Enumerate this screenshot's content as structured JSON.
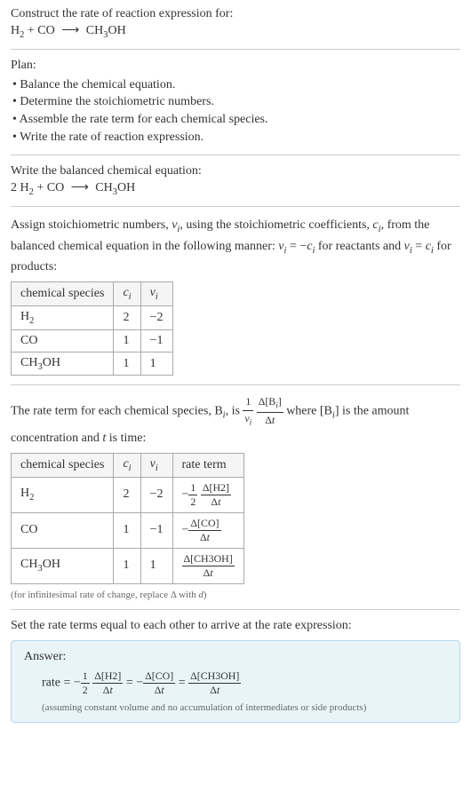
{
  "header": {
    "title": "Construct the rate of reaction expression for:",
    "equation_html": "H<span class='sub'>2</span> + CO <span class='arrow'>⟶</span> CH<span class='sub'>3</span>OH"
  },
  "plan": {
    "label": "Plan:",
    "items": [
      "• Balance the chemical equation.",
      "• Determine the stoichiometric numbers.",
      "• Assemble the rate term for each chemical species.",
      "• Write the rate of reaction expression."
    ]
  },
  "balanced": {
    "label": "Write the balanced chemical equation:",
    "equation_html": "2 H<span class='sub'>2</span> + CO <span class='arrow'>⟶</span> CH<span class='sub'>3</span>OH"
  },
  "stoich": {
    "intro_html": "Assign stoichiometric numbers, <span class='italic'>ν<span class='sub'>i</span></span>, using the stoichiometric coefficients, <span class='italic'>c<span class='sub'>i</span></span>, from the balanced chemical equation in the following manner: <span class='italic'>ν<span class='sub'>i</span></span> = −<span class='italic'>c<span class='sub'>i</span></span> for reactants and <span class='italic'>ν<span class='sub'>i</span></span> = <span class='italic'>c<span class='sub'>i</span></span> for products:",
    "headers": {
      "species": "chemical species",
      "ci_html": "<span class='italic'>c<span class='sub'>i</span></span>",
      "vi_html": "<span class='italic'>ν<span class='sub'>i</span></span>"
    },
    "rows": [
      {
        "species_html": "H<span class='sub'>2</span>",
        "ci": "2",
        "vi": "−2"
      },
      {
        "species_html": "CO",
        "ci": "1",
        "vi": "−1"
      },
      {
        "species_html": "CH<span class='sub'>3</span>OH",
        "ci": "1",
        "vi": "1"
      }
    ]
  },
  "rateterm": {
    "intro_html": "The rate term for each chemical species, B<span class='sub italic'>i</span>, is <span class='frac'><span class='num'>1</span><span class='den'><span class='italic'>ν<span class='sub'>i</span></span></span></span> <span class='frac'><span class='num'>Δ[B<span class='sub italic'>i</span>]</span><span class='den'>Δ<span class='italic'>t</span></span></span> where [B<span class='sub italic'>i</span>] is the amount concentration and <span class='italic'>t</span> is time:",
    "headers": {
      "species": "chemical species",
      "ci_html": "<span class='italic'>c<span class='sub'>i</span></span>",
      "vi_html": "<span class='italic'>ν<span class='sub'>i</span></span>",
      "rate": "rate term"
    },
    "rows": [
      {
        "species_html": "H<span class='sub'>2</span>",
        "ci": "2",
        "vi": "−2",
        "rate_html": "−<span class='frac'><span class='num'>1</span><span class='den'>2</span></span> <span class='frac'><span class='num'>Δ[H2]</span><span class='den'>Δ<span class='italic'>t</span></span></span>"
      },
      {
        "species_html": "CO",
        "ci": "1",
        "vi": "−1",
        "rate_html": "−<span class='frac'><span class='num'>Δ[CO]</span><span class='den'>Δ<span class='italic'>t</span></span></span>"
      },
      {
        "species_html": "CH<span class='sub'>3</span>OH",
        "ci": "1",
        "vi": "1",
        "rate_html": "<span class='frac'><span class='num'>Δ[CH3OH]</span><span class='den'>Δ<span class='italic'>t</span></span></span>"
      }
    ],
    "note_html": "(for infinitesimal rate of change, replace Δ with <span class='italic'>d</span>)"
  },
  "final": {
    "label": "Set the rate terms equal to each other to arrive at the rate expression:"
  },
  "answer": {
    "label": "Answer:",
    "expr_html": "rate = −<span class='frac'><span class='num'>1</span><span class='den'>2</span></span> <span class='frac'><span class='num'>Δ[H2]</span><span class='den'>Δ<span class='italic'>t</span></span></span> = −<span class='frac'><span class='num'>Δ[CO]</span><span class='den'>Δ<span class='italic'>t</span></span></span> = <span class='frac'><span class='num'>Δ[CH3OH]</span><span class='den'>Δ<span class='italic'>t</span></span></span>",
    "note": "(assuming constant volume and no accumulation of intermediates or side products)"
  }
}
